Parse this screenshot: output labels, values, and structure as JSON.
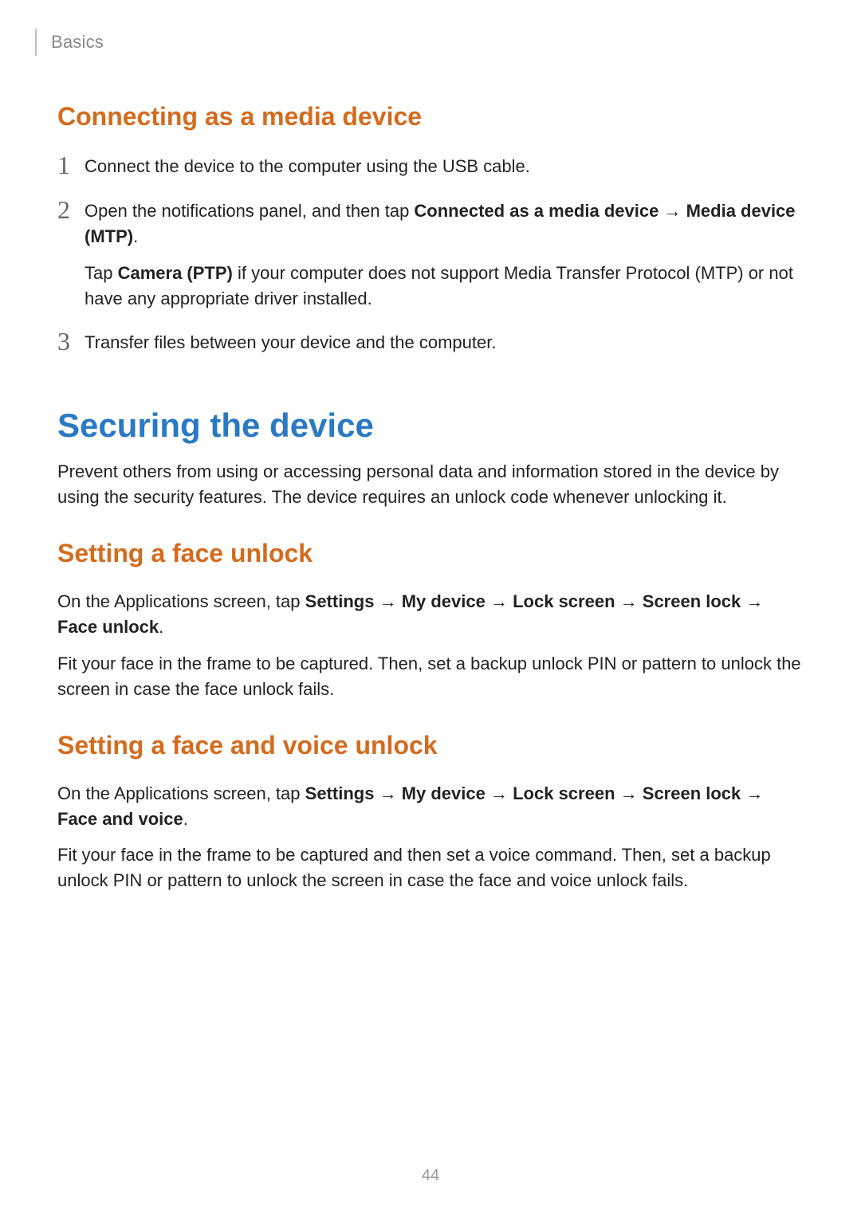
{
  "page_number": "44",
  "chapter": "Basics",
  "arrow": "→",
  "section1": {
    "title": "Connecting as a media device",
    "steps": [
      {
        "num": "1",
        "text": "Connect the device to the computer using the USB cable."
      },
      {
        "num": "2",
        "parts": {
          "pre": "Open the notifications panel, and then tap ",
          "b1": "Connected as a media device",
          "mid1": " ",
          "b2": "Media device (MTP)",
          "post1": ".",
          "para2_pre": "Tap ",
          "para2_b": "Camera (PTP)",
          "para2_post": " if your computer does not support Media Transfer Protocol (MTP) or not have any appropriate driver installed."
        }
      },
      {
        "num": "3",
        "text": "Transfer files between your device and the computer."
      }
    ]
  },
  "section2": {
    "title": "Securing the device",
    "intro": "Prevent others from using or accessing personal data and information stored in the device by using the security features. The device requires an unlock code whenever unlocking it."
  },
  "face_unlock": {
    "title": "Setting a face unlock",
    "p1": {
      "pre": "On the Applications screen, tap ",
      "b1": "Settings",
      "b2": "My device",
      "b3": "Lock screen",
      "b4": "Screen lock",
      "b5": "Face unlock",
      "post": "."
    },
    "p2": "Fit your face in the frame to be captured. Then, set a backup unlock PIN or pattern to unlock the screen in case the face unlock fails."
  },
  "face_voice": {
    "title": "Setting a face and voice unlock",
    "p1": {
      "pre": "On the Applications screen, tap ",
      "b1": "Settings",
      "b2": "My device",
      "b3": "Lock screen",
      "b4": "Screen lock",
      "b5": "Face and voice",
      "post": "."
    },
    "p2": "Fit your face in the frame to be captured and then set a voice command. Then, set a backup unlock PIN or pattern to unlock the screen in case the face and voice unlock fails."
  }
}
